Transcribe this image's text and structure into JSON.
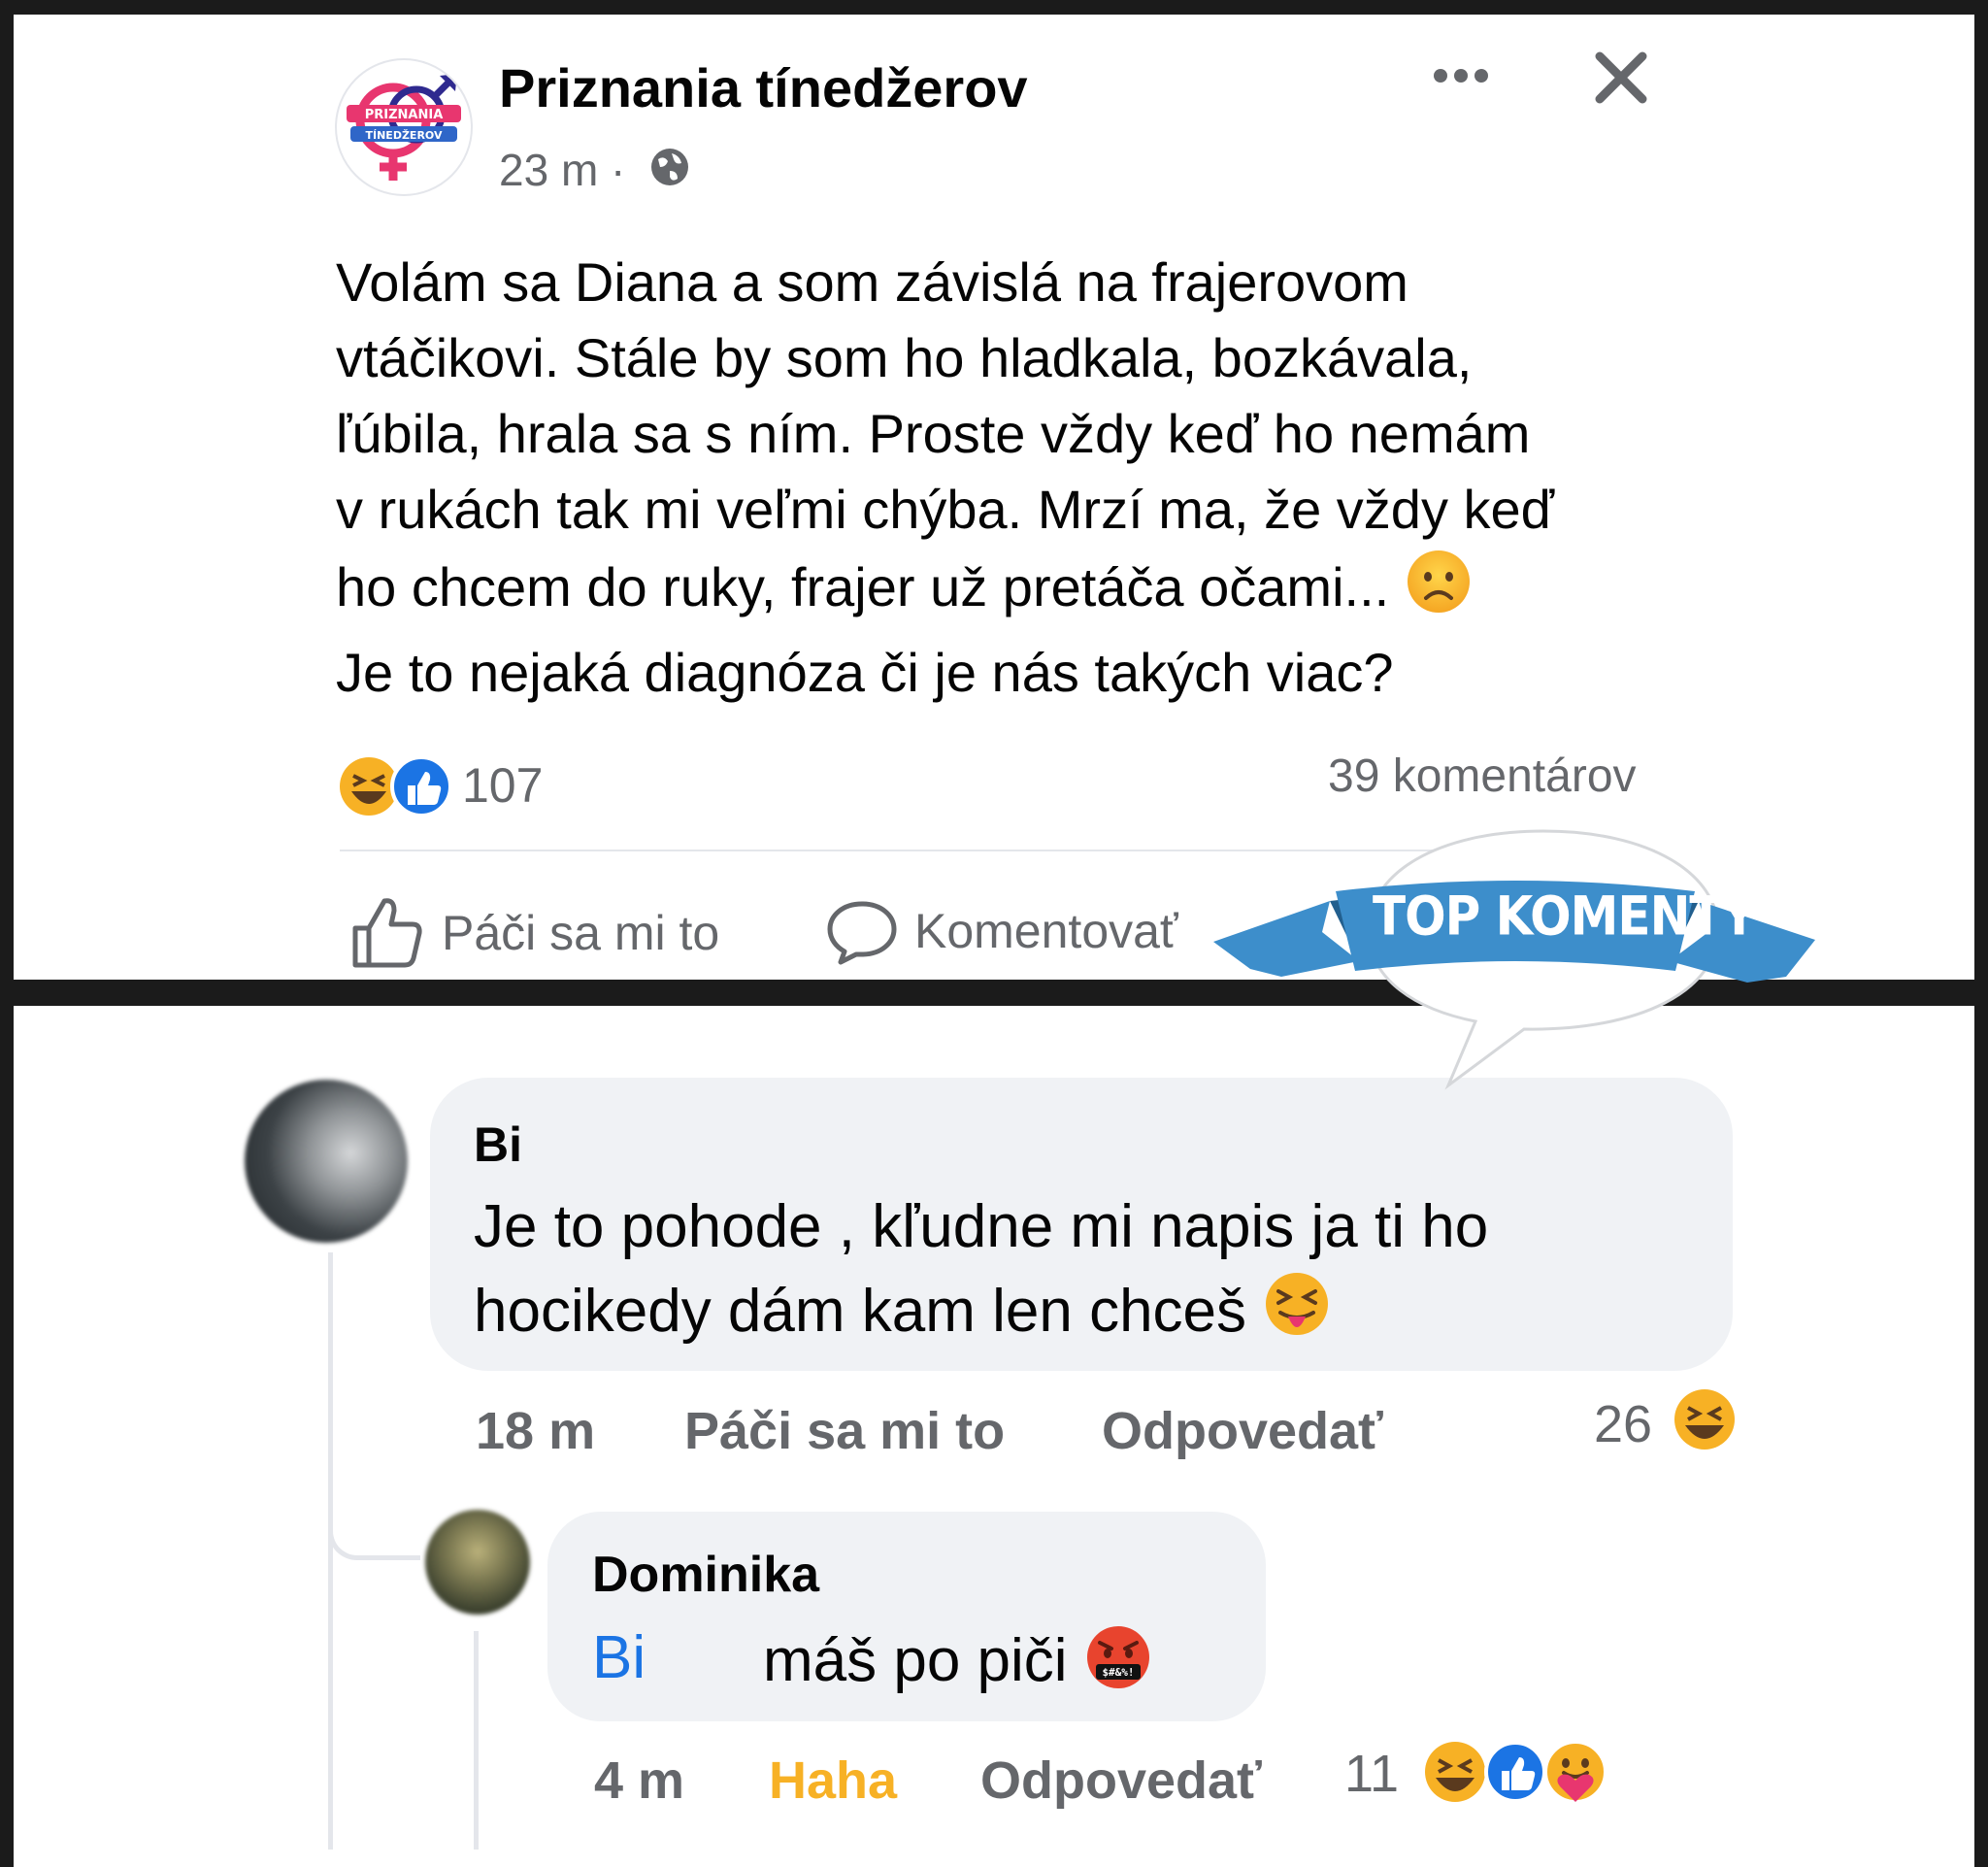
{
  "post": {
    "page_name": "Priznania tínedžerov",
    "logo_text_top": "PRIZNANIA",
    "logo_text_bottom": "TÍNEDŽEROV",
    "time": "23 m ·",
    "text_lines": [
      "Volám sa Diana a som závislá na frajerovom",
      "vtáčikovi. Stále by som ho hladkala, bozkávala,",
      "ľúbila, hrala sa s ním. Proste vždy keď ho nemám",
      "v rukách tak mi veľmi chýba. Mrzí ma, že vždy keď",
      "ho chcem do ruky, frajer už  pretáča očami...",
      "Je to nejaká diagnóza či je nás takých viac?"
    ],
    "reaction_count": "107",
    "comments_count": "39 komentárov",
    "like_label": "Páči sa mi to",
    "comment_label": "Komentovať",
    "icons": [
      "globe-icon",
      "more-icon",
      "close-icon",
      "frowning-emoji",
      "haha-reaction-icon",
      "like-reaction-icon",
      "thumbs-up-icon",
      "comment-icon"
    ]
  },
  "banner": {
    "label": "TOP KOMENTY",
    "color": "#3d8ecb"
  },
  "comments": [
    {
      "author": "Bi",
      "text_line1": "Je to pohode , kľudne mi napis ja ti ho",
      "text_line2": "hocikedy dám kam len chceš",
      "time": "18 m",
      "like_label": "Páči sa mi to",
      "reply_label": "Odpovedať",
      "reaction_count": "26",
      "icons": [
        "squinting-tongue-emoji",
        "haha-reaction-icon"
      ]
    },
    {
      "author": "Dominika",
      "mention": "Bi",
      "text": "máš po piči",
      "time": "4 m",
      "reaction_label": "Haha",
      "reply_label": "Odpovedať",
      "reaction_count": "11",
      "icons": [
        "cursing-face-emoji",
        "haha-reaction-icon",
        "like-reaction-icon",
        "care-reaction-icon"
      ]
    }
  ],
  "colors": {
    "accent": "#1b74e4",
    "haha": "#f7b125",
    "secondary_text": "#65676b",
    "bubble": "#f0f2f5"
  }
}
